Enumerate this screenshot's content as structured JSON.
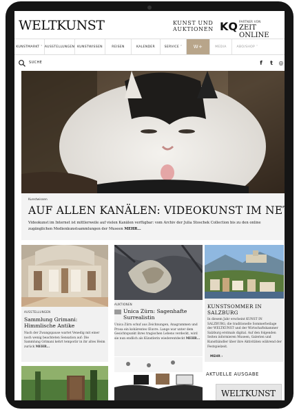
{
  "masthead": {
    "logo": "WELTKUNST",
    "kunst_line1": "KUNST UND",
    "kunst_line2": "AUKTIONEN",
    "kq": "KQ",
    "partner_label": "PARTNER VON",
    "zeit_label": "ZEIT ONLINE"
  },
  "nav": {
    "items": [
      "KUNSTMARKT ˅",
      "AUSSTELLUNGEN",
      "KUNSTWISSEN",
      "REISEN",
      "KALENDER",
      "SERVICE ˅"
    ],
    "wplus": "W+",
    "right_items": [
      "MEDIA",
      "ABO/SHOP ˅"
    ]
  },
  "search": {
    "label": "SUCHE"
  },
  "social": {
    "facebook": "f",
    "twitter": "t",
    "instagram": "◎"
  },
  "hero": {
    "kicker": "Kunstwissen",
    "title": "AUF ALLEN KANÄLEN: VIDEOKUNST IM NETZ",
    "teaser": "Videokunst im Internet ist mittlerweile auf vielen Kanälen verfügbar: vom Archiv der Julia Stoschek Collection bis zu den online zugänglichen Medienkunstsammlungen der Museen",
    "more": "MEHR..."
  },
  "cards": [
    {
      "kicker": "AUSSTELLUNGEN",
      "title": "Sammlung Grimani: Himmlische Antike",
      "text": "Nach der Zwangspause wartet Venedig mit einer noch wenig beachteten Sensation auf: Die Sammlung Grimani kehrt temporär in ihr altes Heim zurück",
      "more": "MEHR..."
    },
    {
      "kicker": "AUKTIONEN",
      "title": "Unica Zürn: Sagenhafte Surrealistin",
      "text": "Unica Zürn schuf aus Zeichnungen, Anagrammen und Prosa ein kohärentes Œuvre. Lange war unter dem Gesichtspunkt ihres tragischen Lebens verdeckt, wird sie nun endlich als Künstlerin wiederentdeckt",
      "more": "MEHR..."
    },
    {
      "kicker": "",
      "title": "KUNSTSOMMER IN SALZBURG",
      "text": "In diesem Jahr erscheint KUNST IN SALZBURG, die traditionelle Sommerbeilage der WELTKUNST und der Wirtschaftskammer Salzburg erstmals digital. Auf den folgenden Seiten informieren Museen, Galerien und Kunsthändler über ihre Aktivitäten während der Festspielzeit.",
      "more": "MEHR ›"
    }
  ],
  "ausgabe": {
    "label": "AKTUELLE AUSGABE",
    "magazine": "WELTKUNST"
  }
}
